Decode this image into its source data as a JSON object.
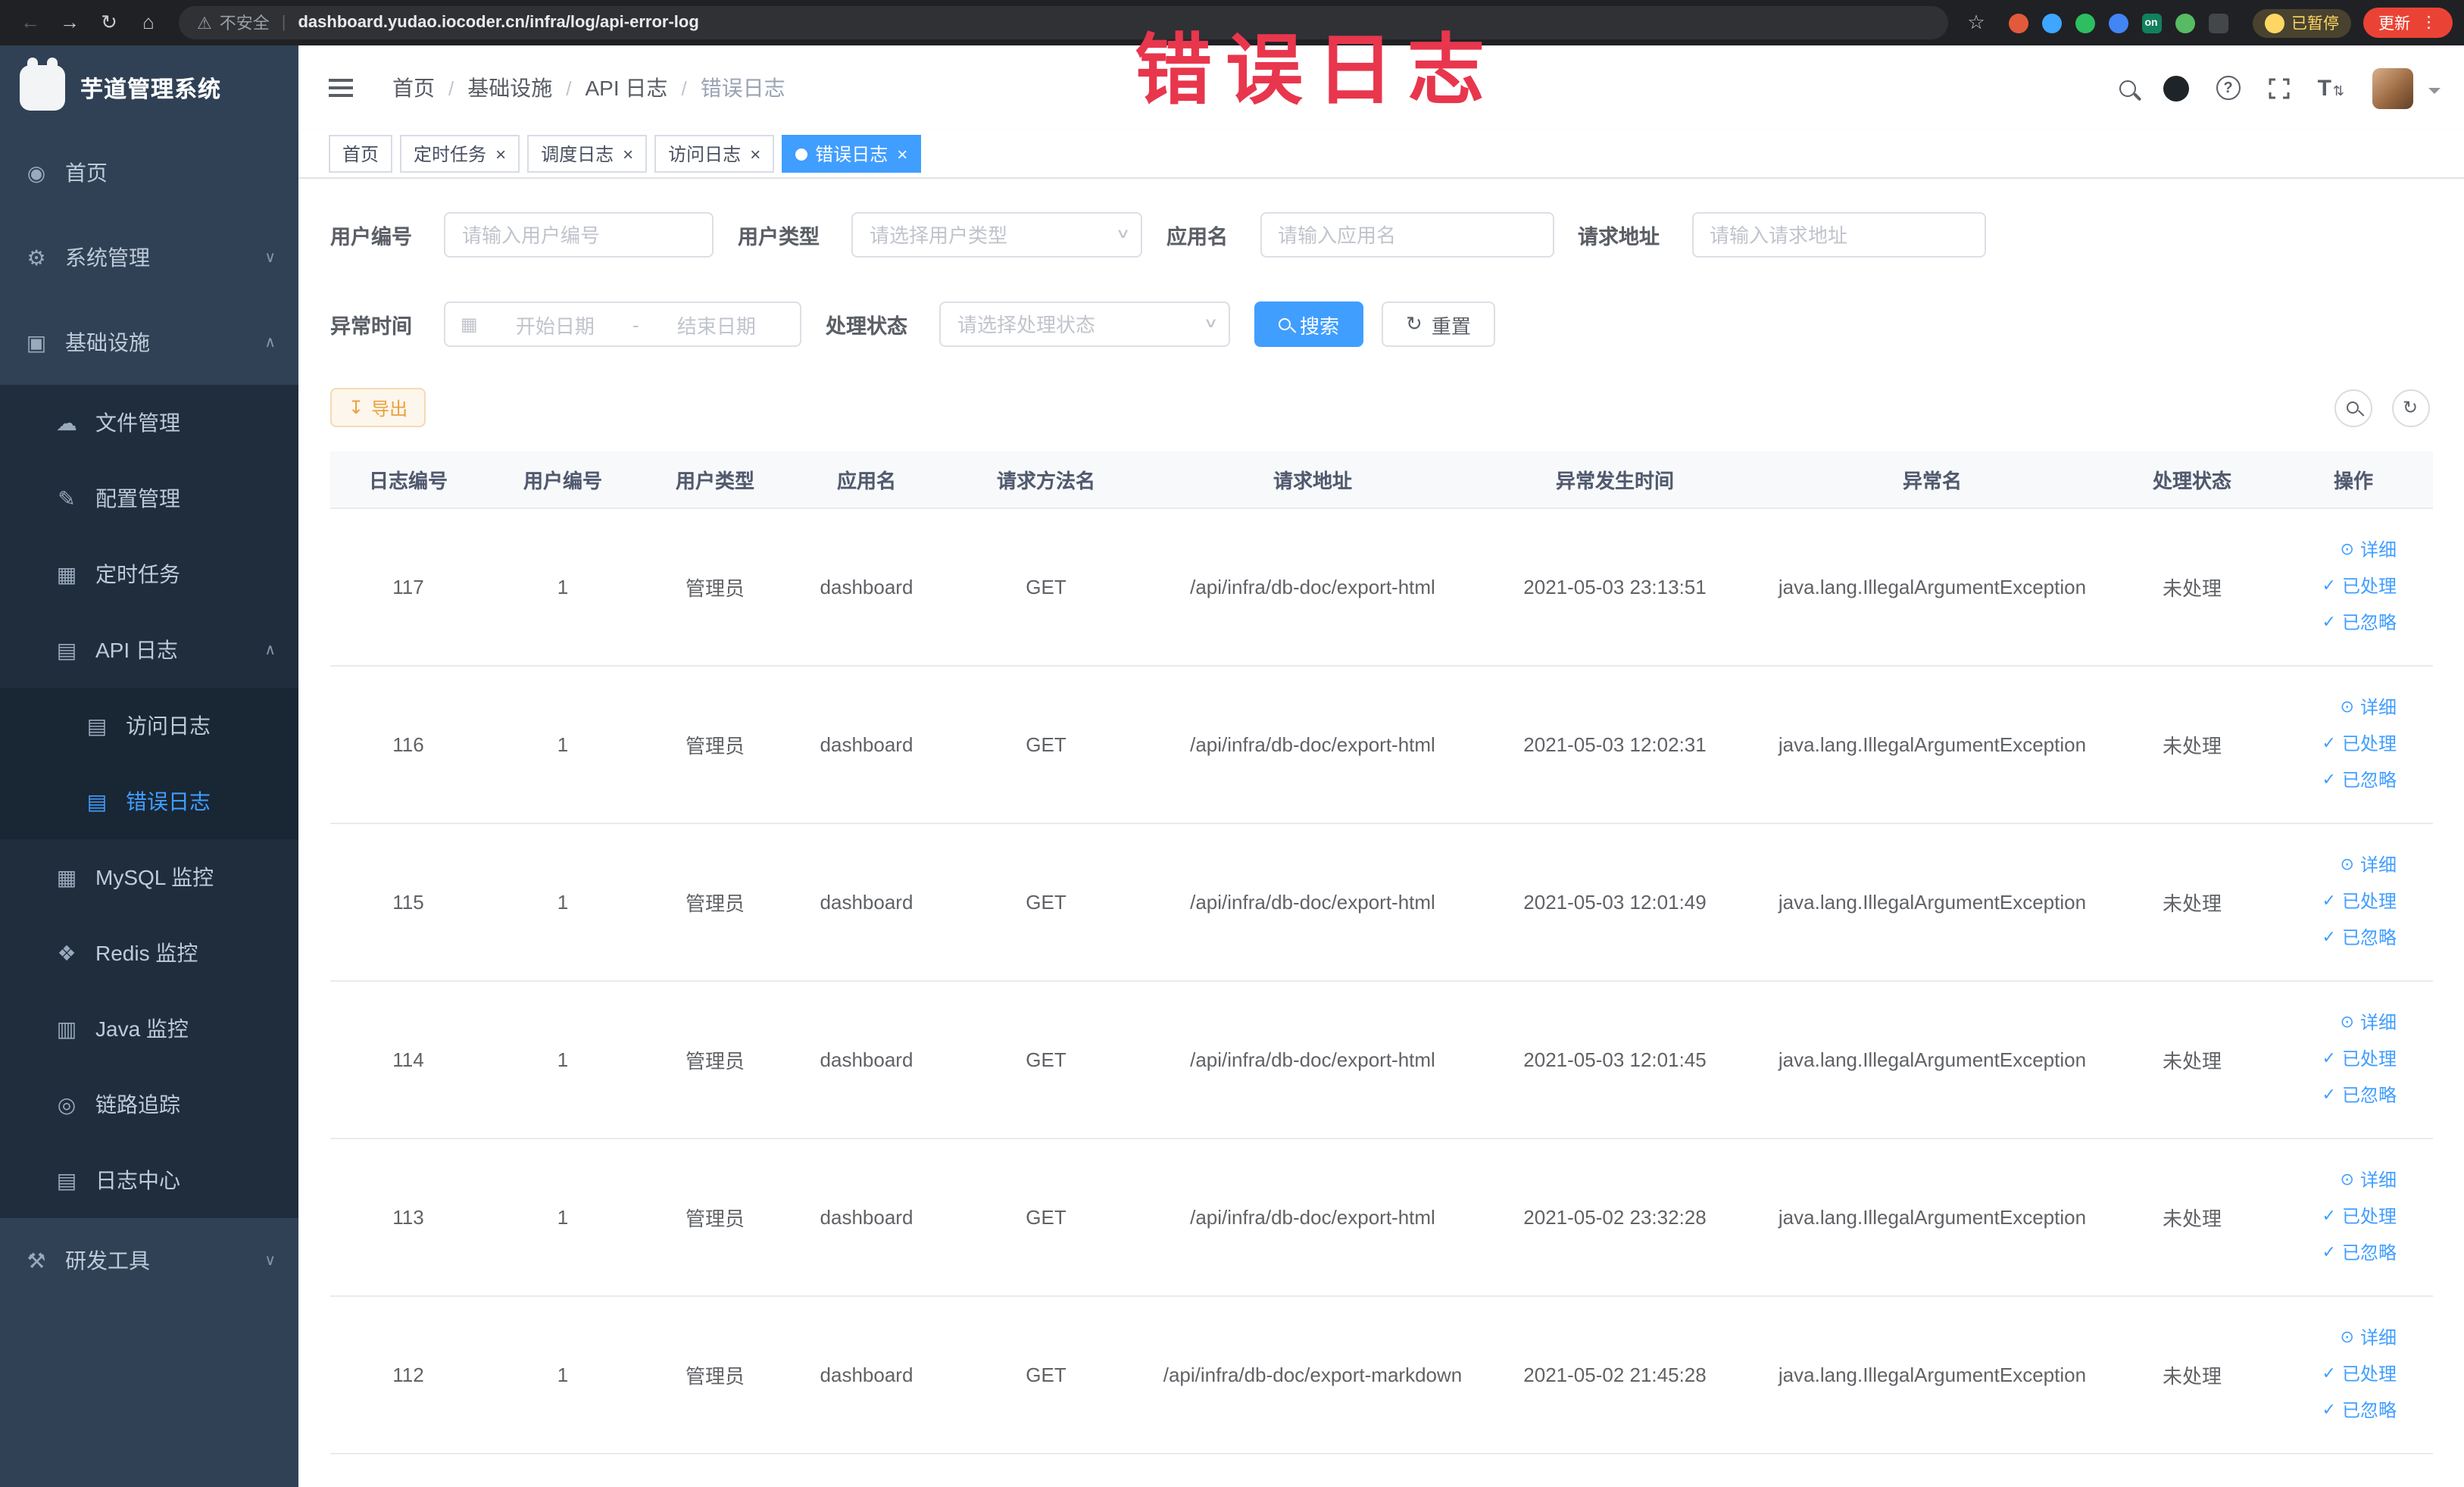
{
  "colors": {
    "primary": "#409eff",
    "sidebar_bg": "#304156",
    "submenu_bg": "#1f2d3d",
    "warning": "#e6a23c",
    "annotation": "#e8364d"
  },
  "icons": {
    "back": "←",
    "forward": "→",
    "reload": "↻",
    "home": "⌂",
    "warning": "⚠",
    "star": "☆",
    "kebab": "⋮",
    "chevron_down": "∨",
    "chevron_up": "∧",
    "close": "×",
    "download": "↧",
    "refresh": "↻",
    "calendar": "▦",
    "eye": "⊙",
    "check": "✓",
    "separator": "/",
    "sidebar": {
      "home-icon": "◉",
      "gear-icon": "⚙",
      "infra-icon": "▣",
      "file-icon": "☁",
      "config-icon": "✎",
      "job-icon": "▦",
      "api-log-icon": "▤",
      "access-log-icon": "▤",
      "error-log-icon": "▤",
      "mysql-icon": "▦",
      "redis-icon": "❖",
      "java-icon": "▥",
      "trace-icon": "◎",
      "log-center-icon": "▤",
      "tools-icon": "⚒"
    }
  },
  "browser": {
    "security_label": "不安全",
    "url": "dashboard.yudao.iocoder.cn/infra/log/api-error-log",
    "paused_badge": "已暂停",
    "update_button": "更新",
    "extensions": [
      {
        "name": "extension-icon",
        "color": "#e2593b"
      },
      {
        "name": "extension-icon",
        "color": "#3ea6ff"
      },
      {
        "name": "extension-icon",
        "color": "#2dbe60"
      },
      {
        "name": "extension-icon",
        "color": "#4285f4"
      },
      {
        "name": "extension-icon",
        "color": "#12805c",
        "shape": "square",
        "label": "on"
      },
      {
        "name": "extension-icon",
        "color": "#57bb63"
      },
      {
        "name": "extension-icon",
        "color": "#44474a",
        "shape": "square"
      }
    ]
  },
  "annotation": {
    "text": "错误日志",
    "color": "#e8364d"
  },
  "sidebar": {
    "logo_title": "芋道管理系统",
    "items": [
      {
        "key": "home",
        "label": "首页",
        "icon": "home-icon",
        "level": 1
      },
      {
        "key": "system-management",
        "label": "系统管理",
        "icon": "gear-icon",
        "level": 1,
        "arrow": "down"
      },
      {
        "key": "infrastructure",
        "label": "基础设施",
        "icon": "infra-icon",
        "level": 1,
        "arrow": "up"
      },
      {
        "key": "file-management",
        "label": "文件管理",
        "icon": "file-icon",
        "level": 2
      },
      {
        "key": "config-management",
        "label": "配置管理",
        "icon": "config-icon",
        "level": 2
      },
      {
        "key": "scheduled-jobs",
        "label": "定时任务",
        "icon": "job-icon",
        "level": 2
      },
      {
        "key": "api-log",
        "label": "API 日志",
        "icon": "api-log-icon",
        "level": 2,
        "arrow": "up"
      },
      {
        "key": "access-log",
        "label": "访问日志",
        "icon": "access-log-icon",
        "level": 3
      },
      {
        "key": "error-log",
        "label": "错误日志",
        "icon": "error-log-icon",
        "level": 3,
        "active": true
      },
      {
        "key": "mysql-monitor",
        "label": "MySQL 监控",
        "icon": "mysql-icon",
        "level": 2
      },
      {
        "key": "redis-monitor",
        "label": "Redis 监控",
        "icon": "redis-icon",
        "level": 2
      },
      {
        "key": "java-monitor",
        "label": "Java 监控",
        "icon": "java-icon",
        "level": 2
      },
      {
        "key": "trace",
        "label": "链路追踪",
        "icon": "trace-icon",
        "level": 2
      },
      {
        "key": "log-center",
        "label": "日志中心",
        "icon": "log-center-icon",
        "level": 2
      },
      {
        "key": "dev-tools",
        "label": "研发工具",
        "icon": "tools-icon",
        "level": 1,
        "arrow": "down"
      }
    ]
  },
  "header": {
    "breadcrumb": [
      {
        "label": "首页"
      },
      {
        "label": "基础设施"
      },
      {
        "label": "API 日志"
      },
      {
        "label": "错误日志",
        "current": true
      }
    ]
  },
  "tabs": [
    {
      "key": "home",
      "label": "首页"
    },
    {
      "key": "scheduled-jobs",
      "label": "定时任务",
      "closable": true
    },
    {
      "key": "schedule-log",
      "label": "调度日志",
      "closable": true
    },
    {
      "key": "access-log",
      "label": "访问日志",
      "closable": true
    },
    {
      "key": "error-log",
      "label": "错误日志",
      "closable": true,
      "active": true
    }
  ],
  "filters": {
    "user_id_label": "用户编号",
    "user_id_placeholder": "请输入用户编号",
    "user_type_label": "用户类型",
    "user_type_placeholder": "请选择用户类型",
    "app_name_label": "应用名",
    "app_name_placeholder": "请输入应用名",
    "request_url_label": "请求地址",
    "request_url_placeholder": "请输入请求地址",
    "exception_time_label": "异常时间",
    "start_date_placeholder": "开始日期",
    "end_date_placeholder": "结束日期",
    "range_separator": "-",
    "process_status_label": "处理状态",
    "process_status_placeholder": "请选择处理状态",
    "search_button": "搜索",
    "reset_button": "重置"
  },
  "toolbar": {
    "export_label": "导出"
  },
  "table": {
    "columns": [
      "日志编号",
      "用户编号",
      "用户类型",
      "应用名",
      "请求方法名",
      "请求地址",
      "异常发生时间",
      "异常名",
      "处理状态",
      "操作"
    ],
    "actions": [
      {
        "key": "detail",
        "label": "详细",
        "icon": "eye"
      },
      {
        "key": "processed",
        "label": "已处理",
        "icon": "check"
      },
      {
        "key": "ignored",
        "label": "已忽略",
        "icon": "check"
      }
    ],
    "rows": [
      {
        "id": "117",
        "user_id": "1",
        "user_type": "管理员",
        "app": "dashboard",
        "method": "GET",
        "url": "/api/infra/db-doc/export-html",
        "time": "2021-05-03 23:13:51",
        "exception": "java.lang.IllegalArgumentException",
        "status": "未处理"
      },
      {
        "id": "116",
        "user_id": "1",
        "user_type": "管理员",
        "app": "dashboard",
        "method": "GET",
        "url": "/api/infra/db-doc/export-html",
        "time": "2021-05-03 12:02:31",
        "exception": "java.lang.IllegalArgumentException",
        "status": "未处理"
      },
      {
        "id": "115",
        "user_id": "1",
        "user_type": "管理员",
        "app": "dashboard",
        "method": "GET",
        "url": "/api/infra/db-doc/export-html",
        "time": "2021-05-03 12:01:49",
        "exception": "java.lang.IllegalArgumentException",
        "status": "未处理"
      },
      {
        "id": "114",
        "user_id": "1",
        "user_type": "管理员",
        "app": "dashboard",
        "method": "GET",
        "url": "/api/infra/db-doc/export-html",
        "time": "2021-05-03 12:01:45",
        "exception": "java.lang.IllegalArgumentException",
        "status": "未处理"
      },
      {
        "id": "113",
        "user_id": "1",
        "user_type": "管理员",
        "app": "dashboard",
        "method": "GET",
        "url": "/api/infra/db-doc/export-html",
        "time": "2021-05-02 23:32:28",
        "exception": "java.lang.IllegalArgumentException",
        "status": "未处理"
      },
      {
        "id": "112",
        "user_id": "1",
        "user_type": "管理员",
        "app": "dashboard",
        "method": "GET",
        "url": "/api/infra/db-doc/export-markdown",
        "time": "2021-05-02 21:45:28",
        "exception": "java.lang.IllegalArgumentException",
        "status": "未处理"
      }
    ]
  }
}
